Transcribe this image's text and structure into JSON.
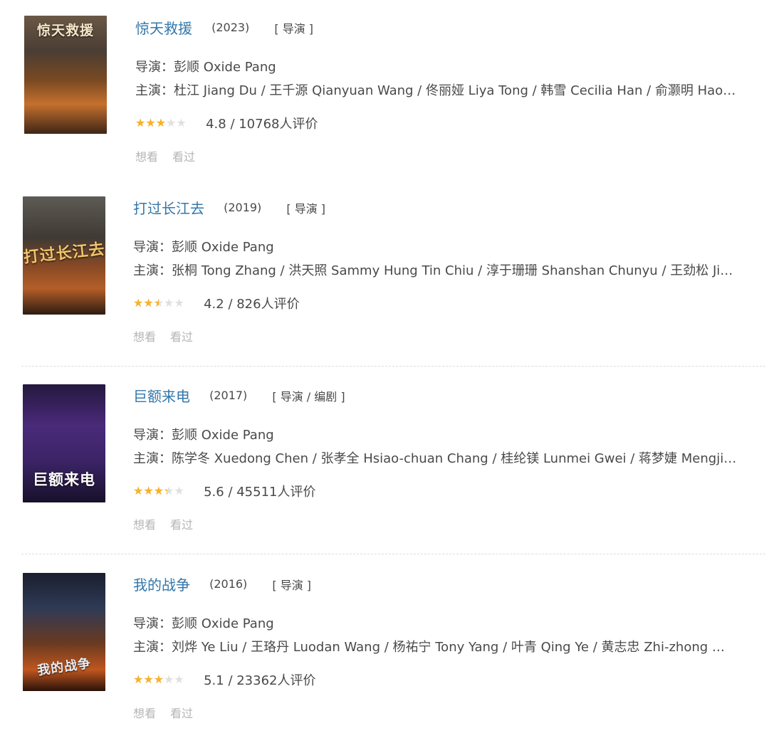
{
  "colors": {
    "title_link": "#3377aa",
    "text": "#494949",
    "muted": "#b5b5b5",
    "star_filled": "#f5b22b",
    "star_empty": "#e0e0e0"
  },
  "labels": {
    "director_prefix": "导演：",
    "cast_prefix": "主演：",
    "want_to_watch": "想看",
    "watched": "看过"
  },
  "movies": [
    {
      "title": "惊天救援",
      "year": "(2023)",
      "role": "[ 导演 ]",
      "director": "彭顺 Oxide Pang",
      "cast": "杜江 Jiang Du / 王千源 Qianyuan Wang / 佟丽娅 Liya Tong / 韩雪 Cecilia Han / 俞灏明 Hao…",
      "stars_fraction": 0.48,
      "rating_text": "4.8 / 10768人评价",
      "poster_title": "惊天救援"
    },
    {
      "title": "打过长江去",
      "year": "(2019)",
      "role": "[ 导演 ]",
      "director": "彭顺 Oxide Pang",
      "cast": "张桐 Tong Zhang / 洪天照 Sammy Hung Tin Chiu / 淳于珊珊 Shanshan Chunyu / 王劲松 Ji…",
      "stars_fraction": 0.42,
      "rating_text": "4.2 / 826人评价",
      "poster_title": "打过长江去"
    },
    {
      "title": "巨额来电",
      "year": "(2017)",
      "role": "[ 导演 / 编剧 ]",
      "director": "彭顺 Oxide Pang",
      "cast": "陈学冬 Xuedong Chen / 张孝全 Hsiao-chuan Chang / 桂纶镁 Lunmei Gwei / 蒋梦婕 Mengji…",
      "stars_fraction": 0.56,
      "rating_text": "5.6 / 45511人评价",
      "poster_title": "巨额来电"
    },
    {
      "title": "我的战争",
      "year": "(2016)",
      "role": "[ 导演 ]",
      "director": "彭顺 Oxide Pang",
      "cast": "刘烨 Ye Liu / 王珞丹 Luodan Wang / 杨祐宁 Tony Yang / 叶青 Qing Ye / 黄志忠 Zhi-zhong …",
      "stars_fraction": 0.51,
      "rating_text": "5.1 / 23362人评价",
      "poster_title": "我的战争"
    }
  ]
}
